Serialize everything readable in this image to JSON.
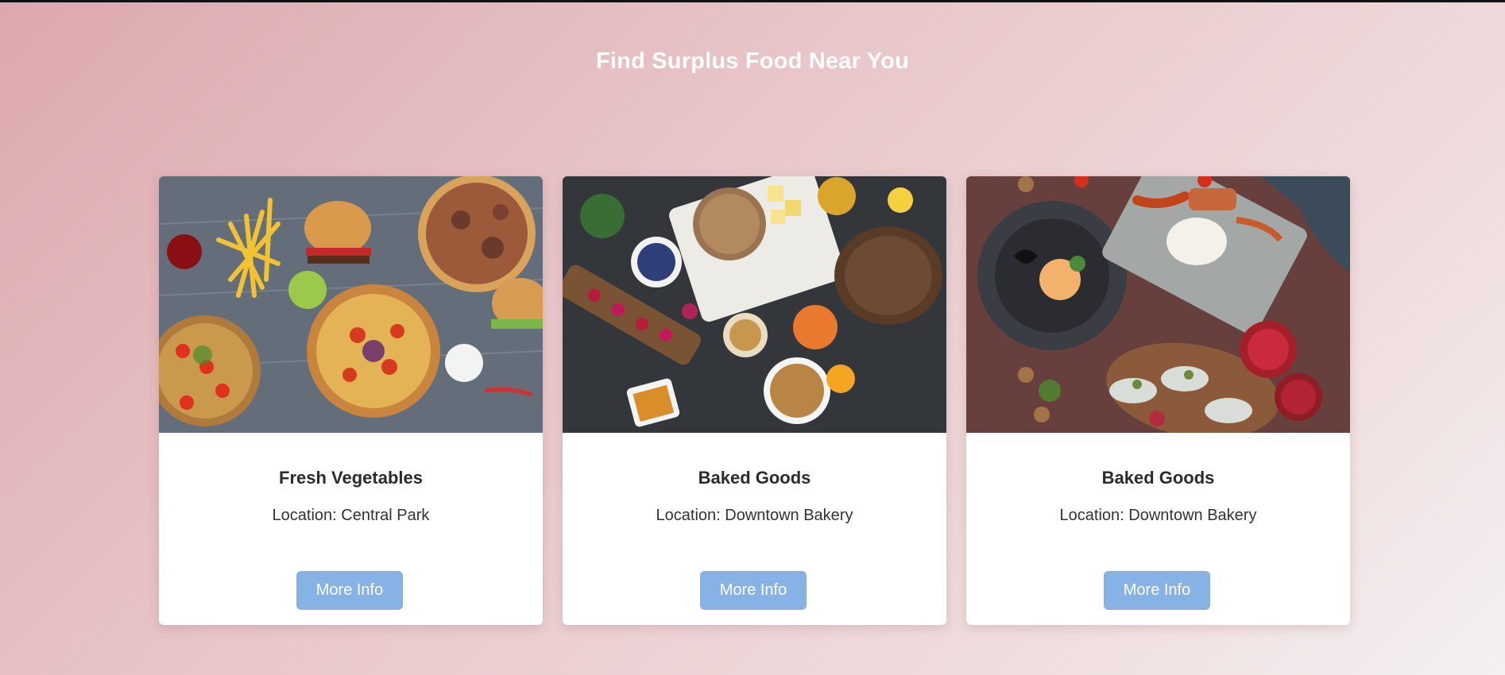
{
  "header": {
    "title": "Find Surplus Food Near You"
  },
  "cards": [
    {
      "title": "Fresh Vegetables",
      "location": "Location: Central Park",
      "button_label": "More Info",
      "image_alt": "Fast food spread with pizzas, burgers and fries"
    },
    {
      "title": "Baked Goods",
      "location": "Location: Downtown Bakery",
      "button_label": "More Info",
      "image_alt": "Breads, berries, nuts and cheese on dark table"
    },
    {
      "title": "Baked Goods",
      "location": "Location: Downtown Bakery",
      "button_label": "More Info",
      "image_alt": "Plated dishes with oysters and pomegranate"
    }
  ],
  "colors": {
    "button": "#86b2e6",
    "title_text": "#ffffff",
    "card_background": "#ffffff"
  }
}
